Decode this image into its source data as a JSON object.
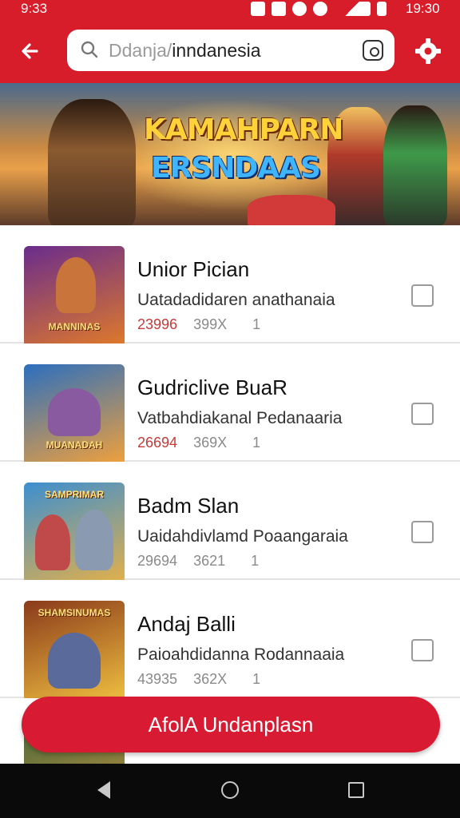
{
  "status_bar": {
    "time_left": "9:33",
    "time_right": "19:30"
  },
  "header": {
    "search": {
      "placeholder_part": "Ddanja/",
      "query_part": "inndanesia"
    }
  },
  "banner": {
    "title_line1": "KAMAHPARN",
    "title_line2": "ERSNDAAS"
  },
  "games": [
    {
      "name": "Unior Pician",
      "description": "Uatadadidaren anathanaia",
      "stat1": "23996",
      "stat2": "399X",
      "stat3": "1",
      "thumb_label": "MANNINAS",
      "thumb_colors": [
        "#6a2c8c",
        "#e07a2a"
      ]
    },
    {
      "name": "Gudriclive BuaR",
      "description": "Vatbahdiakanal Pedanaaria",
      "stat1": "26694",
      "stat2": "369X",
      "stat3": "1",
      "thumb_label": "MUANADAH",
      "thumb_colors": [
        "#2b6fbf",
        "#f2a13a"
      ]
    },
    {
      "name": "Badm Slan",
      "description": "Uaidahdivlamd Poaangaraia",
      "stat1": "29694",
      "stat2": "3621",
      "stat3": "1",
      "thumb_label": "SAMPRIMAR",
      "thumb_colors": [
        "#3d8fd0",
        "#e3b04a"
      ]
    },
    {
      "name": "Andaj Balli",
      "description": "Paioahdidanna Rodannaaia",
      "stat1": "43935",
      "stat2": "362X",
      "stat3": "1",
      "thumb_label": "SHAMSINUMAS",
      "thumb_colors": [
        "#8a3a1a",
        "#f0c040"
      ]
    }
  ],
  "cta": {
    "label": "AfolA Undanplasn"
  },
  "colors": {
    "brand_red": "#d71c2a",
    "cta_red": "#d91a33"
  }
}
